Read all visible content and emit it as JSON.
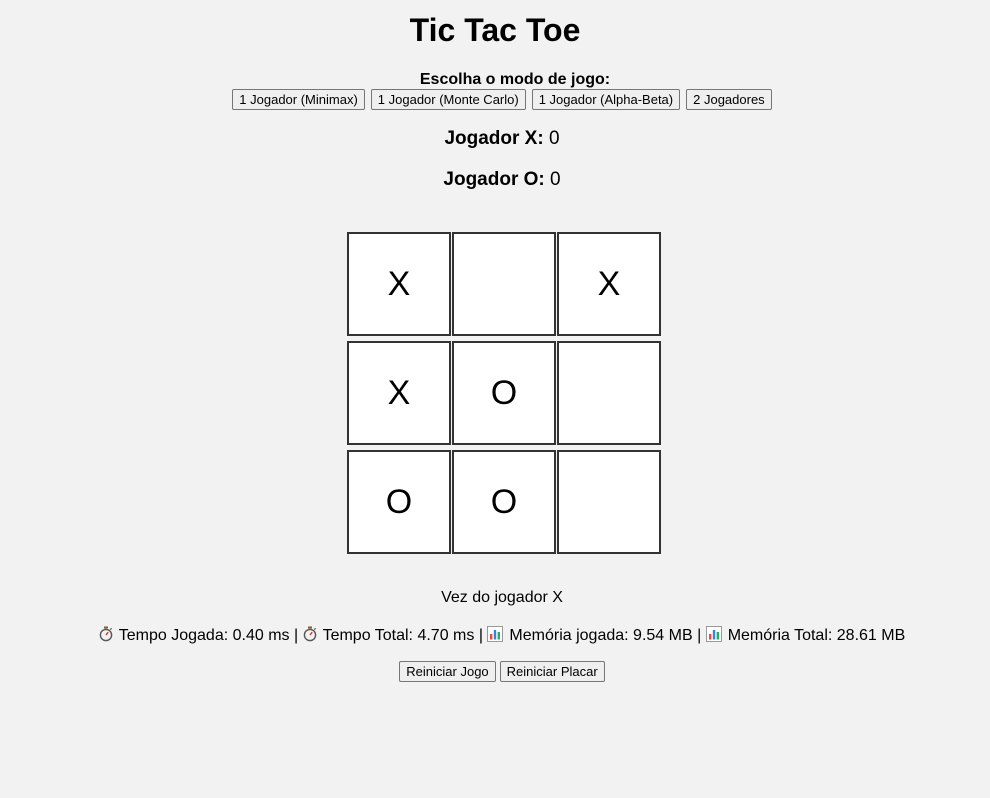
{
  "title": "Tic Tac Toe",
  "mode_label": "Escolha o modo de jogo:",
  "mode_buttons": [
    "1 Jogador (Minimax)",
    "1 Jogador (Monte Carlo)",
    "1 Jogador (Alpha-Beta)",
    "2 Jogadores"
  ],
  "score": {
    "x_label": "Jogador X:",
    "x_value": "0",
    "o_label": "Jogador O:",
    "o_value": "0"
  },
  "board": [
    "X",
    "",
    "X",
    "X",
    "O",
    "",
    "O",
    "O",
    ""
  ],
  "status": "Vez do jogador X",
  "stats": {
    "move_time": "Tempo Jogada: 0.40 ms",
    "total_time": "Tempo Total: 4.70 ms",
    "move_memory": "Memória jogada: 9.54 MB",
    "total_memory": "Memória Total: 28.61 MB",
    "separator": "|",
    "timer_icon": "stopwatch-icon",
    "memory_icon": "bar-chart-icon"
  },
  "actions": {
    "restart_game": "Reiniciar Jogo",
    "restart_score": "Reiniciar Placar"
  }
}
